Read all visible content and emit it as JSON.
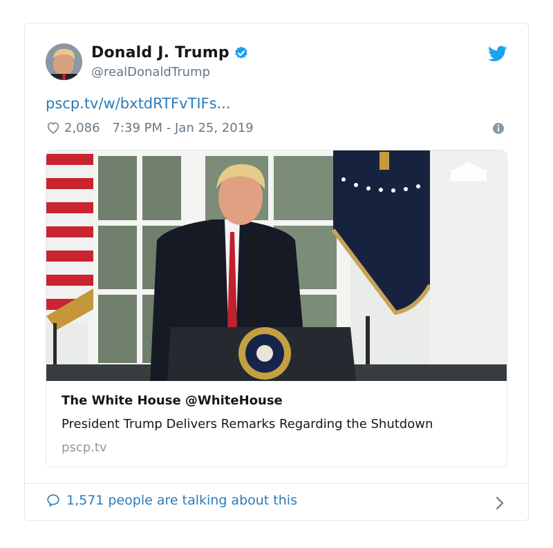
{
  "tweet": {
    "display_name": "Donald J. Trump",
    "handle": "@realDonaldTrump",
    "link_text": "pscp.tv/w/bxtdRTFvTIFs...",
    "likes": "2,086",
    "timestamp": "7:39 PM - Jan 25, 2019"
  },
  "card": {
    "title": "The White House @WhiteHouse",
    "description": "President Trump Delivers Remarks Regarding the Shutdown",
    "domain": "pscp.tv"
  },
  "footer": {
    "talking_text": "1,571 people are talking about this"
  },
  "colors": {
    "twitter_blue": "#1da1f2",
    "link_blue": "#2b7bb9",
    "muted_gray": "#657786",
    "border": "#e1e8ed"
  },
  "icons": {
    "verified": "verified-badge-icon",
    "logo": "twitter-bird-icon",
    "like": "heart-outline-icon",
    "info": "info-circle-icon",
    "reply": "speech-bubble-icon",
    "next": "chevron-right-icon"
  }
}
